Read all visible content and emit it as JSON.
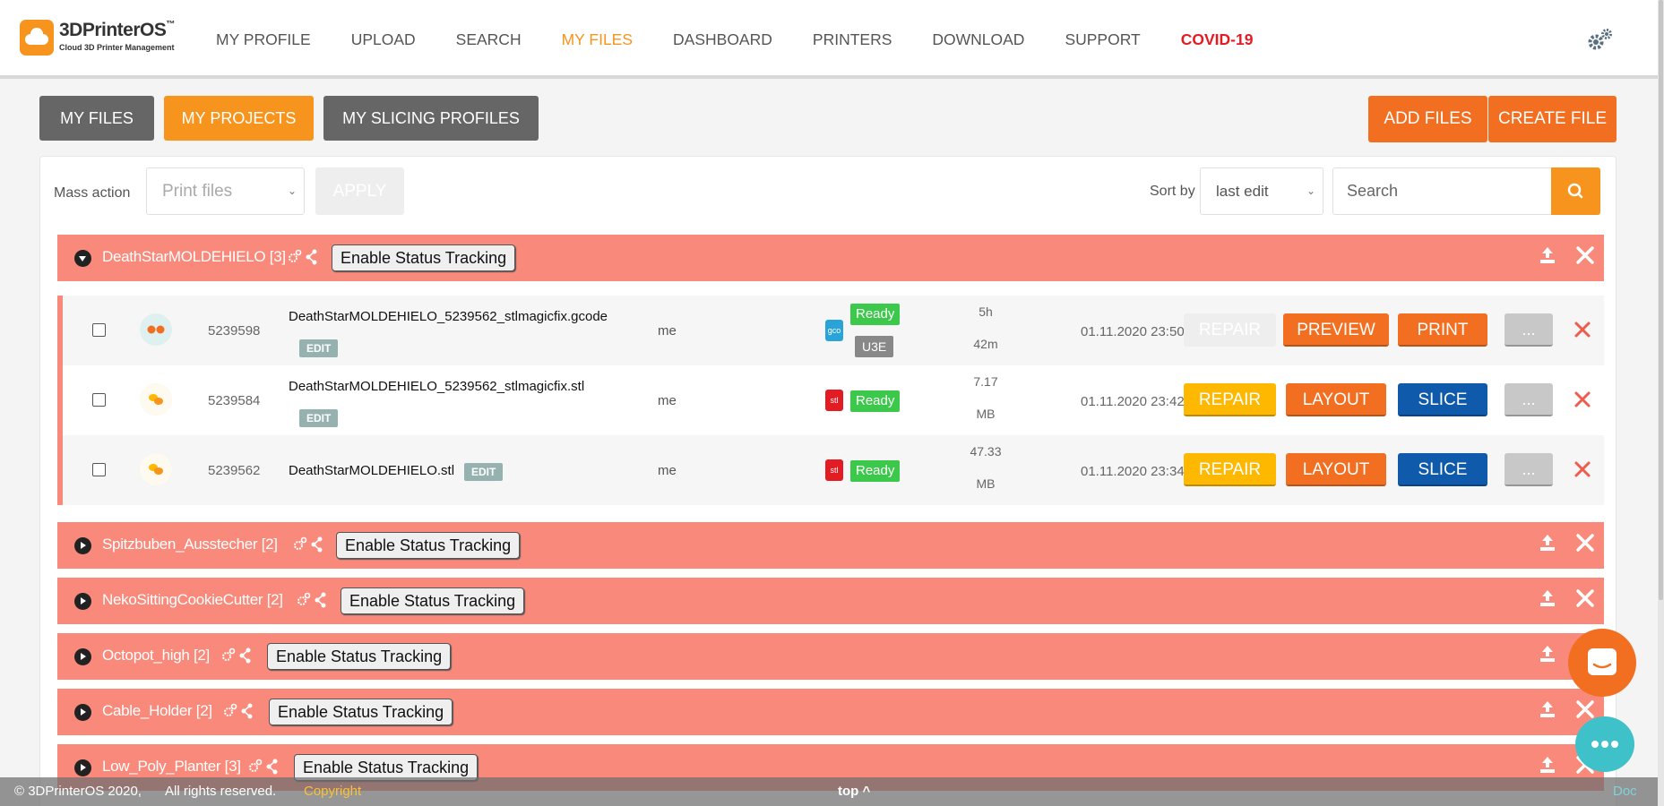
{
  "brand": {
    "name": "3DPrinterOS",
    "tm": "™",
    "tagline": "Cloud 3D Printer Management"
  },
  "nav": [
    {
      "label": "MY PROFILE",
      "active": false
    },
    {
      "label": "UPLOAD",
      "active": false
    },
    {
      "label": "SEARCH",
      "active": false
    },
    {
      "label": "MY FILES",
      "active": true
    },
    {
      "label": "DASHBOARD",
      "active": false
    },
    {
      "label": "PRINTERS",
      "active": false
    },
    {
      "label": "DOWNLOAD",
      "active": false
    },
    {
      "label": "SUPPORT",
      "active": false
    },
    {
      "label": "COVID-19",
      "active": false
    }
  ],
  "tabs": {
    "my_files": "MY FILES",
    "my_projects": "MY PROJECTS",
    "my_slicing_profiles": "MY SLICING PROFILES"
  },
  "actions": {
    "add_files": "ADD FILES",
    "create_file": "CREATE FILE"
  },
  "toolbar": {
    "mass_action_label": "Mass action",
    "mass_action_value": "Print files",
    "apply_label": "APPLY",
    "sort_label": "Sort by",
    "sort_value": "last edit",
    "search_placeholder": "Search"
  },
  "track_label": "Enable Status Tracking",
  "projects": [
    {
      "name": "DeathStarMOLDEHIELO",
      "count": "[3]",
      "expanded": true
    },
    {
      "name": "Spitzbuben_Ausstecher",
      "count": "[2]",
      "expanded": false
    },
    {
      "name": "NekoSittingCookieCutter",
      "count": "[2]",
      "expanded": false
    },
    {
      "name": "Octopot_high",
      "count": "[2]",
      "expanded": false
    },
    {
      "name": "Cable_Holder",
      "count": "[2]",
      "expanded": false
    },
    {
      "name": "Low_Poly_Planter",
      "count": "[3]",
      "expanded": false
    }
  ],
  "files": [
    {
      "id": "5239598",
      "name": "DeathStarMOLDEHIELO_5239562_stlmagicfix.gcode",
      "edit": "EDIT",
      "owner": "me",
      "type": "gco",
      "status": "Ready",
      "printer": "U3E",
      "size_line1": "5h",
      "size_line2": "42m",
      "date": "01.11.2020 23:50",
      "buttons": [
        "REPAIR",
        "PREVIEW",
        "PRINT"
      ],
      "more": "..."
    },
    {
      "id": "5239584",
      "name": "DeathStarMOLDEHIELO_5239562_stlmagicfix.stl",
      "edit": "EDIT",
      "owner": "me",
      "type": "stl",
      "status": "Ready",
      "size_line1": "7.17",
      "size_line2": "MB",
      "date": "01.11.2020 23:42",
      "buttons": [
        "REPAIR",
        "LAYOUT",
        "SLICE"
      ],
      "more": "..."
    },
    {
      "id": "5239562",
      "name": "DeathStarMOLDEHIELO.stl",
      "edit": "EDIT",
      "owner": "me",
      "type": "stl",
      "status": "Ready",
      "size_line1": "47.33",
      "size_line2": "MB",
      "date": "01.11.2020 23:34",
      "buttons": [
        "REPAIR",
        "LAYOUT",
        "SLICE"
      ],
      "more": "..."
    }
  ],
  "footer": {
    "copyright": "© 3DPrinterOS 2020,",
    "rights": "All rights reserved.",
    "copyright_link": "Copyright",
    "top": "top ^",
    "doc": "Doc"
  },
  "colors": {
    "accent": "#f7941d",
    "action": "#f26f21",
    "project_bar": "#f98a7b",
    "covid": "#e31b23",
    "slice": "#0f5aab",
    "repair": "#ffb800",
    "ready": "#3cc84b"
  }
}
